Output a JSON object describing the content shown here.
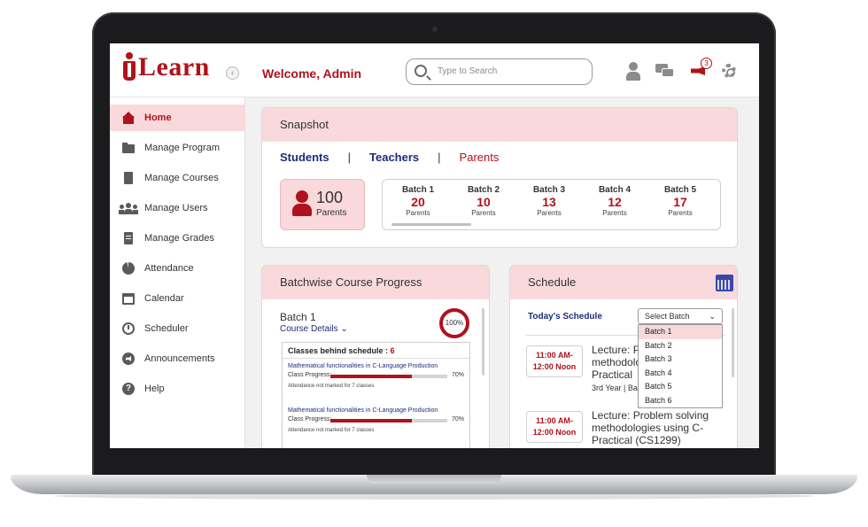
{
  "brand": {
    "logo_text": "Learn",
    "accent": "#b0121b",
    "pink": "#f9d9dc",
    "navy": "#1b2d7a"
  },
  "header": {
    "collapse_glyph": "‹",
    "welcome": "Welcome, Admin",
    "search_placeholder": "Type to Search",
    "notification_count": "3",
    "icons": [
      "search-icon",
      "user-icon",
      "chat-icon",
      "megaphone-icon",
      "gear-icon"
    ]
  },
  "sidebar": {
    "items": [
      {
        "label": "Home",
        "icon": "home-icon",
        "active": true
      },
      {
        "label": "Manage Program",
        "icon": "folder-icon"
      },
      {
        "label": "Manage Courses",
        "icon": "book-icon"
      },
      {
        "label": "Manage Users",
        "icon": "users-icon"
      },
      {
        "label": "Manage Grades",
        "icon": "grades-icon"
      },
      {
        "label": "Attendance",
        "icon": "pie-chart-icon"
      },
      {
        "label": "Calendar",
        "icon": "calendar-icon"
      },
      {
        "label": "Scheduler",
        "icon": "clock-icon"
      },
      {
        "label": "Announcements",
        "icon": "announcement-icon"
      },
      {
        "label": "Help",
        "icon": "help-icon"
      }
    ]
  },
  "snapshot": {
    "title": "Snapshot",
    "tabs": [
      {
        "label": "Students"
      },
      {
        "label": "Teachers"
      },
      {
        "label": "Parents",
        "active": true
      }
    ],
    "separator": "|",
    "total": {
      "value": "100",
      "label": "Parents"
    },
    "batches": [
      {
        "name": "Batch 1",
        "value": "20",
        "label": "Parents"
      },
      {
        "name": "Batch 2",
        "value": "10",
        "label": "Parents"
      },
      {
        "name": "Batch 3",
        "value": "13",
        "label": "Parents"
      },
      {
        "name": "Batch 4",
        "value": "12",
        "label": "Parents"
      },
      {
        "name": "Batch 5",
        "value": "17",
        "label": "Parents"
      }
    ]
  },
  "progress": {
    "title": "Batchwise Course Progress",
    "batch": "Batch 1",
    "course_details": "Course Details",
    "completion": "100%",
    "behind_label": "Classes behind schedule : ",
    "behind_count": "6",
    "classes": [
      {
        "title": "Mathematical functionalities in C-Language Production",
        "progress_label": "Class Progress:",
        "progress_pct": "70%",
        "progress_value": 70,
        "attendance": "Attendance not marked for 7 classes"
      },
      {
        "title": "Mathematical functionalities in C-Language Production",
        "progress_label": "Class Progress:",
        "progress_pct": "70%",
        "progress_value": 70,
        "attendance": "Attendance not marked for 7 classes"
      }
    ]
  },
  "schedule": {
    "title": "Schedule",
    "todays": "Today's Schedule",
    "select_value": "Select Batch",
    "options": [
      "Batch 1",
      "Batch 2",
      "Batch 3",
      "Batch 4",
      "Batch 5",
      "Batch 6"
    ],
    "selected_option": "Batch 1",
    "entries": [
      {
        "time_start": "11:00 AM-",
        "time_end": "12:00 Noon",
        "lecture_lines": [
          "Lecture: P",
          "methodolo",
          "Practical"
        ],
        "meta": "3rd Year | Ba"
      },
      {
        "time_start": "11:00 AM-",
        "time_end": "12:00 Noon",
        "lecture_lines": [
          "Lecture: Problem solving",
          "methodologies using C-",
          "Practical (CS1299)"
        ],
        "meta": ""
      }
    ]
  }
}
